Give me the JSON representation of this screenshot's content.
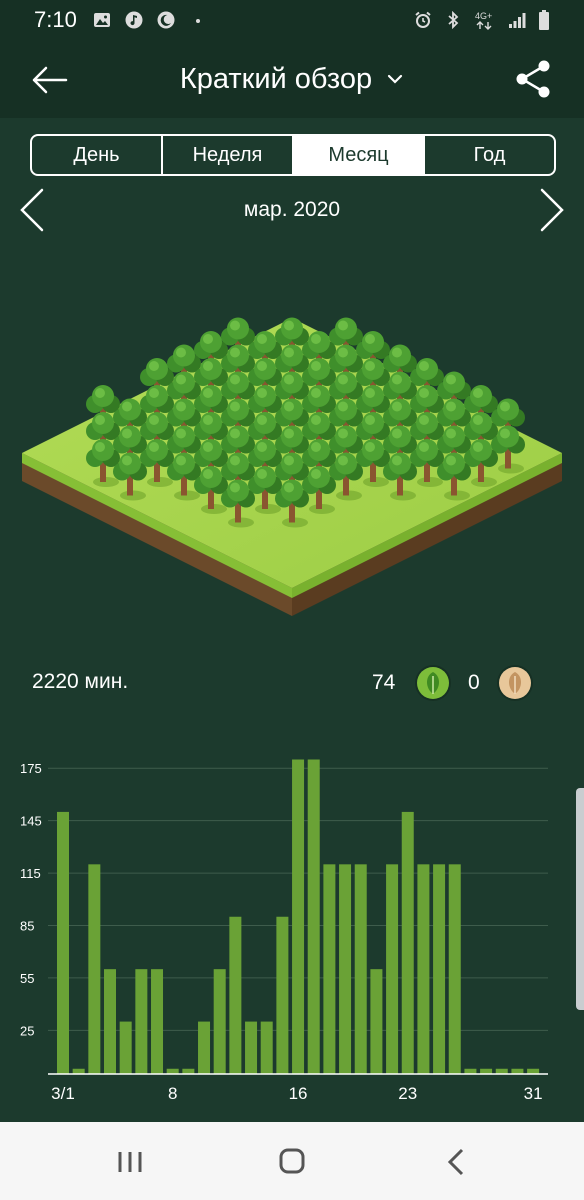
{
  "status_bar": {
    "time": "7:10",
    "left_icons": [
      "image-icon",
      "music-icon",
      "moon-icon",
      "dot-icon"
    ],
    "right_icons": [
      "alarm-icon",
      "bluetooth-icon",
      "network-4g-icon",
      "signal-icon",
      "battery-icon"
    ],
    "network_label": "4G+"
  },
  "header": {
    "title": "Краткий обзор",
    "back_icon": "arrow-left-icon",
    "dropdown_icon": "chevron-down-icon",
    "share_icon": "share-icon"
  },
  "tabs": [
    {
      "label": "День",
      "active": false
    },
    {
      "label": "Неделя",
      "active": false
    },
    {
      "label": "Месяц",
      "active": true
    },
    {
      "label": "Год",
      "active": false
    }
  ],
  "period": {
    "label": "мар. 2020"
  },
  "summary": {
    "total_minutes": "2220 мин.",
    "healthy_trees": "74",
    "dead_trees": "0"
  },
  "colors": {
    "background": "#1c3a2d",
    "header": "#163024",
    "bar": "#6aa236",
    "healthy": "#7dbd3a",
    "dead": "#e8c79a"
  },
  "chart_data": {
    "type": "bar",
    "categories": [
      "1",
      "2",
      "3",
      "4",
      "5",
      "6",
      "7",
      "8",
      "9",
      "10",
      "11",
      "12",
      "13",
      "14",
      "15",
      "16",
      "17",
      "18",
      "19",
      "20",
      "21",
      "22",
      "23",
      "24",
      "25",
      "26",
      "27",
      "28",
      "29",
      "30",
      "31"
    ],
    "values": [
      150,
      3,
      120,
      60,
      30,
      60,
      60,
      3,
      3,
      30,
      60,
      90,
      30,
      30,
      90,
      180,
      180,
      120,
      120,
      120,
      60,
      120,
      150,
      120,
      120,
      120,
      3,
      3,
      3,
      3,
      3
    ],
    "x_tick_labels": [
      {
        "day": 1,
        "label": "3/1"
      },
      {
        "day": 8,
        "label": "8"
      },
      {
        "day": 16,
        "label": "16"
      },
      {
        "day": 23,
        "label": "23"
      },
      {
        "day": 31,
        "label": "31"
      }
    ],
    "y_ticks": [
      25,
      55,
      85,
      115,
      145,
      175
    ],
    "ylim": [
      0,
      182
    ],
    "grid": true
  }
}
